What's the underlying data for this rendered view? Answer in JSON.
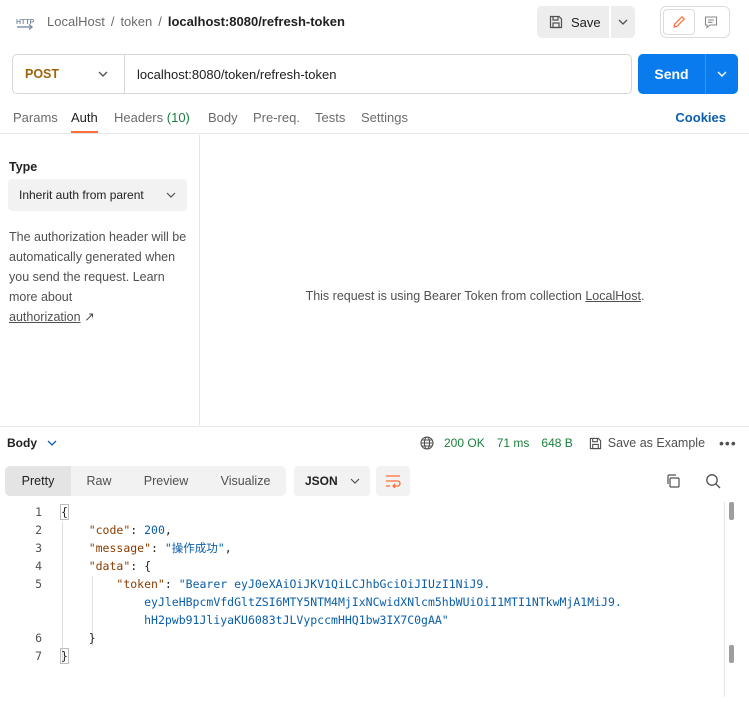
{
  "breadcrumb": {
    "collection": "LocalHost",
    "folder": "token",
    "request": "localhost:8080/refresh-token"
  },
  "toolbar": {
    "save_label": "Save"
  },
  "request": {
    "method": "POST",
    "url": "localhost:8080/token/refresh-token",
    "send_label": "Send"
  },
  "tabs": {
    "params": "Params",
    "auth": "Auth",
    "headers": "Headers",
    "headers_count": "(10)",
    "body": "Body",
    "prereq": "Pre-req.",
    "tests": "Tests",
    "settings": "Settings",
    "cookies": "Cookies"
  },
  "auth": {
    "type_label": "Type",
    "type_value": "Inherit auth from parent",
    "help_text": "The authorization header will be automatically generated when you send the request. Learn more about",
    "help_link": "authorization",
    "help_arrow": "↗",
    "bearer_prefix": "This request is using Bearer Token from collection",
    "bearer_collection": "LocalHost",
    "bearer_suffix": "."
  },
  "response": {
    "body_label": "Body",
    "status": "200 OK",
    "time": "71 ms",
    "size": "648 B",
    "save_example": "Save as Example",
    "more": "•••",
    "views": [
      "Pretty",
      "Raw",
      "Preview",
      "Visualize"
    ],
    "format": "JSON"
  },
  "code_lines": [
    {
      "ln": "1",
      "parts": [
        {
          "t": "{",
          "c": "p"
        }
      ]
    },
    {
      "ln": "2",
      "parts": [
        {
          "t": "    ",
          "c": "p"
        },
        {
          "t": "\"code\"",
          "c": "k"
        },
        {
          "t": ": ",
          "c": "p"
        },
        {
          "t": "200",
          "c": "n"
        },
        {
          "t": ",",
          "c": "p"
        }
      ]
    },
    {
      "ln": "3",
      "parts": [
        {
          "t": "    ",
          "c": "p"
        },
        {
          "t": "\"message\"",
          "c": "k"
        },
        {
          "t": ": ",
          "c": "p"
        },
        {
          "t": "\"操作成功\"",
          "c": "s"
        },
        {
          "t": ",",
          "c": "p"
        }
      ]
    },
    {
      "ln": "4",
      "parts": [
        {
          "t": "    ",
          "c": "p"
        },
        {
          "t": "\"data\"",
          "c": "k"
        },
        {
          "t": ": {",
          "c": "p"
        }
      ]
    },
    {
      "ln": "5",
      "parts": [
        {
          "t": "        ",
          "c": "p"
        },
        {
          "t": "\"token\"",
          "c": "k"
        },
        {
          "t": ": ",
          "c": "p"
        },
        {
          "t": "\"Bearer eyJ0eXAiOiJKV1QiLCJhbGciOiJIUzI1NiJ9.",
          "c": "s"
        }
      ]
    },
    {
      "ln": "",
      "parts": [
        {
          "t": "            ",
          "c": "p"
        },
        {
          "t": "eyJleHBpcmVfdGltZSI6MTY5NTM4MjIxNCwidXNlcm5hbWUiOiI1MTI1NTkwMjA1MiJ9.",
          "c": "s"
        }
      ]
    },
    {
      "ln": "",
      "parts": [
        {
          "t": "            ",
          "c": "p"
        },
        {
          "t": "hH2pwb91JliyaKU6083tJLVypccmHHQ1bw3IX7C0gAA\"",
          "c": "s"
        }
      ]
    },
    {
      "ln": "6",
      "parts": [
        {
          "t": "    }",
          "c": "p"
        }
      ]
    },
    {
      "ln": "7",
      "parts": [
        {
          "t": "}",
          "c": "p"
        }
      ]
    }
  ],
  "colors": {
    "accent": "#ff6c37",
    "send": "#097bed",
    "method_post": "#a0620a",
    "status_ok": "#1a7f3c"
  }
}
